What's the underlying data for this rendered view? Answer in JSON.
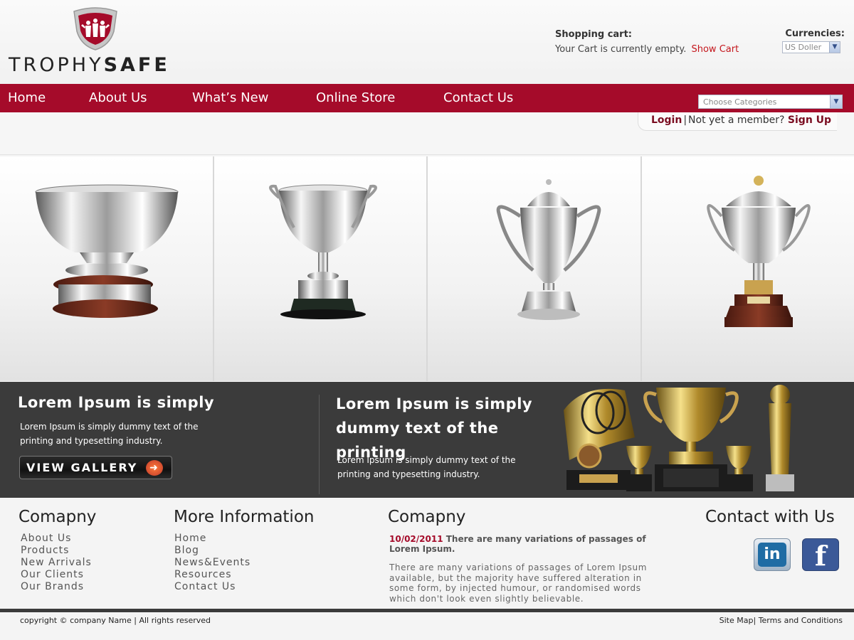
{
  "brand": {
    "logo_light": "TROPHY",
    "logo_bold": "SAFE"
  },
  "cart": {
    "title": "Shopping cart:",
    "message": "Your Cart is currently empty.",
    "link": "Show Cart"
  },
  "currency": {
    "title": "Currencies:",
    "selected": "US Doller"
  },
  "nav": {
    "items": [
      "Home",
      "About Us",
      "What’s New",
      "Online Store",
      "Contact Us"
    ],
    "category_placeholder": "Choose Categories"
  },
  "account": {
    "login": "Login",
    "separator": "|",
    "prompt": "Not yet a member?",
    "signup": "Sign Up"
  },
  "promo": {
    "left_heading": "Lorem Ipsum is simply",
    "left_text": "Lorem Ipsum is simply dummy text of the printing and typesetting industry.",
    "button": "VIEW GALLERY",
    "right_heading": "Lorem Ipsum is simply dummy text of the printing",
    "right_text": "Lorem Ipsum is simply dummy text of the printing and typesetting industry."
  },
  "footer": {
    "company_heading": "Comapny",
    "company_links": [
      "About Us",
      "Products",
      "New Arrivals",
      "Our Clients",
      "Our Brands"
    ],
    "more_heading": "More Information",
    "more_links": [
      "Home",
      "Blog",
      "News&Events",
      "Resources",
      "Contact Us"
    ],
    "news_heading": "Comapny",
    "news_date": "10/02/2011",
    "news_title": "There are many variations of passages of Lorem Ipsum.",
    "news_body": "There are many variations of passages of Lorem Ipsum available, but the majority have suffered alteration in some form, by injected humour, or randomised words which don't look even slightly believable.",
    "contact_heading": "Contact with Us",
    "linkedin": "in",
    "facebook": "f",
    "copyright": "copyright © company Name | All rights reserved",
    "site_map": "Site Map",
    "terms": "Terms and Conditions"
  },
  "colors": {
    "accent": "#a50b2a",
    "dark_band": "#3b3b3b",
    "link_red": "#c4161c"
  }
}
